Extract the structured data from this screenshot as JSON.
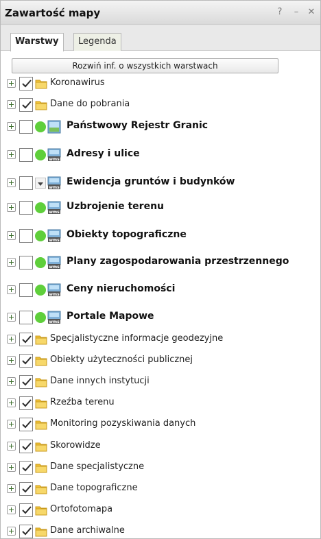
{
  "panel": {
    "title": "Zawartość mapy",
    "help_glyph": "?",
    "min_glyph": "–",
    "close_glyph": "✕"
  },
  "tabs": [
    {
      "label": "Warstwy",
      "active": true
    },
    {
      "label": "Legenda",
      "active": false
    }
  ],
  "expand_all_label": "Rozwiń inf. o wszystkich warstwach",
  "layers": [
    {
      "label": "Koronawirus",
      "type": "folder",
      "checked": true
    },
    {
      "label": "Dane do pobrania",
      "type": "folder",
      "checked": true
    },
    {
      "label": "Państwowy Rejestr Granic",
      "type": "service",
      "checked": false,
      "status": "green"
    },
    {
      "label": "Adresy i ulice",
      "type": "wms",
      "checked": false,
      "status": "green"
    },
    {
      "label": "Ewidencja gruntów i budynków",
      "type": "wms",
      "checked": false,
      "status": "dropdown"
    },
    {
      "label": "Uzbrojenie terenu",
      "type": "wms",
      "checked": false,
      "status": "green"
    },
    {
      "label": "Obiekty topograficzne",
      "type": "wms",
      "checked": false,
      "status": "green"
    },
    {
      "label": "Plany zagospodarowania przestrzennego",
      "type": "wms",
      "checked": false,
      "status": "green"
    },
    {
      "label": "Ceny nieruchomości",
      "type": "wms",
      "checked": false,
      "status": "green"
    },
    {
      "label": "Portale Mapowe",
      "type": "wms",
      "checked": false,
      "status": "green"
    },
    {
      "label": "Specjalistyczne informacje geodezyjne",
      "type": "folder",
      "checked": true
    },
    {
      "label": "Obiekty użyteczności publicznej",
      "type": "folder",
      "checked": true
    },
    {
      "label": "Dane innych instytucji",
      "type": "folder",
      "checked": true
    },
    {
      "label": "Rzeźba terenu",
      "type": "folder",
      "checked": true
    },
    {
      "label": "Monitoring pozyskiwania danych",
      "type": "folder",
      "checked": true
    },
    {
      "label": "Skorowidze",
      "type": "folder",
      "checked": true
    },
    {
      "label": "Dane specjalistyczne",
      "type": "folder",
      "checked": true
    },
    {
      "label": "Dane topograficzne",
      "type": "folder",
      "checked": true
    },
    {
      "label": "Ortofotomapa",
      "type": "folder",
      "checked": true
    },
    {
      "label": "Dane archiwalne",
      "type": "folder",
      "checked": true
    }
  ],
  "icons": {
    "expand": "plus-icon",
    "folder": "folder-icon",
    "wms": "wms-layer-icon",
    "service": "map-service-icon",
    "status": "status-dot-icon",
    "dropdown": "dropdown-arrow-icon"
  },
  "colors": {
    "status_green": "#5fcf3b",
    "folder_yellow": "#f2c437",
    "titlebar": "#e2e2e2"
  }
}
